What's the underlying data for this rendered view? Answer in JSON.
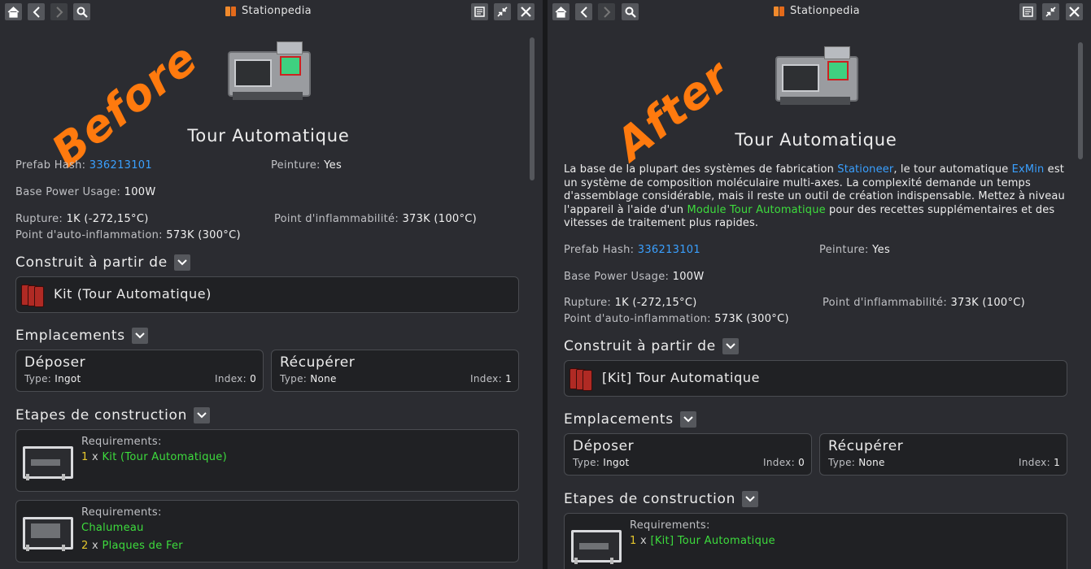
{
  "left": {
    "watermark": "Before",
    "window_title": "Stationpedia",
    "item_title": "Tour Automatique",
    "stats": {
      "prefab_hash_label": "Prefab Hash:",
      "prefab_hash_value": "336213101",
      "paint_label": "Peinture:",
      "paint_value": "Yes",
      "power_label": "Base Power Usage:",
      "power_value": "100W",
      "rupture_label": "Rupture:",
      "rupture_value": "1K (-272,15°C)",
      "flammability_label": "Point d'inflammabilité:",
      "flammability_value": "373K (100°C)",
      "autoignition_label": "Point d'auto-inflammation:",
      "autoignition_value": "573K (300°C)"
    },
    "built_from_heading": "Construit à partir de",
    "kit_label": "Kit (Tour Automatique)",
    "slots_heading": "Emplacements",
    "slots": [
      {
        "name": "Déposer",
        "type_label": "Type:",
        "type_value": "Ingot",
        "index_label": "Index:",
        "index_value": "0"
      },
      {
        "name": "Récupérer",
        "type_label": "Type:",
        "type_value": "None",
        "index_label": "Index:",
        "index_value": "1"
      }
    ],
    "steps_heading": "Etapes de construction",
    "steps": [
      {
        "heading": "Requirements:",
        "lines": [
          {
            "count": "1",
            "x": "x",
            "item": "Kit (Tour Automatique)"
          }
        ]
      },
      {
        "heading": "Requirements:",
        "tool": "Chalumeau",
        "lines": [
          {
            "count": "2",
            "x": "x",
            "item": "Plaques de Fer"
          }
        ]
      }
    ]
  },
  "right": {
    "watermark": "After",
    "window_title": "Stationpedia",
    "item_title": "Tour Automatique",
    "description": {
      "p1": "La base de la plupart des systèmes de fabrication ",
      "link1": "Stationeer",
      "p2": ", le tour automatique ",
      "link2": "ExMin",
      "p3": " est un système de composition moléculaire multi-axes. La complexité demande un temps d'assemblage considérable, mais il reste un outil de création indispensable. Mettez à niveau l'appareil à l'aide d'un ",
      "link3": "Module Tour Automatique",
      "p4": " pour des recettes supplémentaires et des vitesses de traitement plus rapides."
    },
    "stats": {
      "prefab_hash_label": "Prefab Hash:",
      "prefab_hash_value": "336213101",
      "paint_label": "Peinture:",
      "paint_value": "Yes",
      "power_label": "Base Power Usage:",
      "power_value": "100W",
      "rupture_label": "Rupture:",
      "rupture_value": "1K (-272,15°C)",
      "flammability_label": "Point d'inflammabilité:",
      "flammability_value": "373K (100°C)",
      "autoignition_label": "Point d'auto-inflammation:",
      "autoignition_value": "573K (300°C)"
    },
    "built_from_heading": "Construit à partir de",
    "kit_label": "[Kit] Tour Automatique",
    "slots_heading": "Emplacements",
    "slots": [
      {
        "name": "Déposer",
        "type_label": "Type:",
        "type_value": "Ingot",
        "index_label": "Index:",
        "index_value": "0"
      },
      {
        "name": "Récupérer",
        "type_label": "Type:",
        "type_value": "None",
        "index_label": "Index:",
        "index_value": "1"
      }
    ],
    "steps_heading": "Etapes de construction",
    "steps": [
      {
        "heading": "Requirements:",
        "lines": [
          {
            "count": "1",
            "x": "x",
            "item": "[Kit] Tour Automatique"
          }
        ]
      }
    ]
  },
  "icons": {
    "home": "home-icon",
    "back": "back-arrow-icon",
    "forward": "forward-arrow-icon",
    "search": "search-icon",
    "book": "book-icon",
    "notes": "notes-icon",
    "minimize": "minimize-icon",
    "close": "close-icon",
    "chevron": "chevron-down-icon"
  },
  "colors": {
    "link": "#3aa0ff",
    "item_link": "#3ddc3d",
    "count": "#e6c72c",
    "watermark": "#ff7a0e"
  }
}
